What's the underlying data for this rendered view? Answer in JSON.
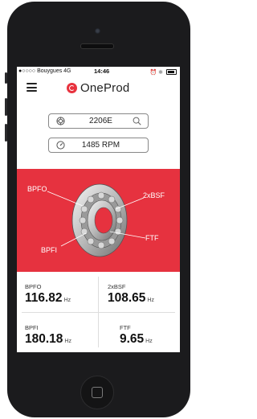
{
  "status_bar": {
    "carrier": "●○○○○ Bouygues 4G",
    "time": "14:46"
  },
  "app": {
    "logo_text": "OneProd",
    "brand_color": "#e6323f"
  },
  "bearing_field": {
    "value": "2206E",
    "icon": "bearing-icon",
    "search_icon": "search-icon"
  },
  "speed_field": {
    "value": "1485 RPM",
    "icon": "gauge-icon"
  },
  "diagram": {
    "labels": {
      "bpfo": "BPFO",
      "bsf": "2xBSF",
      "ftf": "FTF",
      "bpfi": "BPFI"
    }
  },
  "frequencies": [
    {
      "name": "BPFO",
      "value": "116.82",
      "unit": "Hz"
    },
    {
      "name": "2xBSF",
      "value": "108.65",
      "unit": "Hz"
    },
    {
      "name": "BPFI",
      "value": "180.18",
      "unit": "Hz"
    },
    {
      "name": "FTF",
      "value": "9.65",
      "unit": "Hz"
    }
  ]
}
